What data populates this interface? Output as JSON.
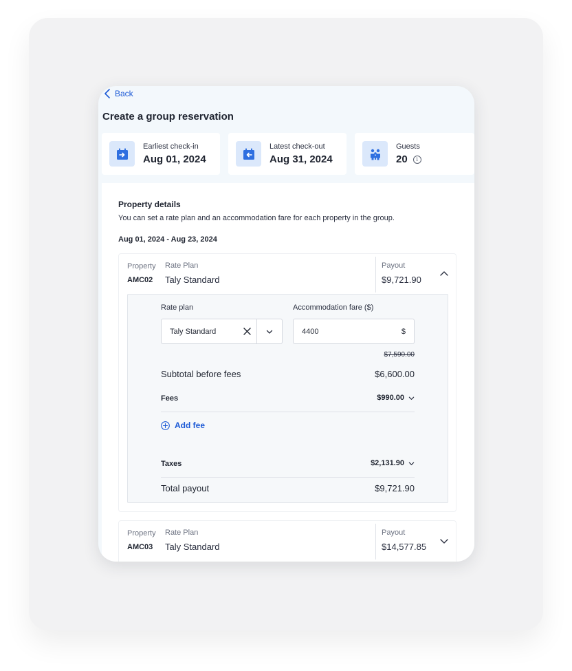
{
  "nav": {
    "back_label": "Back"
  },
  "page": {
    "title": "Create a group reservation"
  },
  "summary": {
    "checkin_label": "Earliest check-in",
    "checkin_value": "Aug 01, 2024",
    "checkout_label": "Latest check-out",
    "checkout_value": "Aug 31, 2024",
    "guests_label": "Guests",
    "guests_value": "20",
    "info_glyph": "i"
  },
  "details": {
    "title": "Property details",
    "description": "You can set a rate plan and an accommodation fare for each property in the group.",
    "date_range": "Aug 01, 2024 - Aug 23, 2024"
  },
  "properties": [
    {
      "property_label": "Property",
      "code": "AMC02",
      "rate_plan_label": "Rate Plan",
      "rate_plan": "Taly Standard",
      "payout_label": "Payout",
      "payout": "$9,721.90",
      "expanded": true
    },
    {
      "property_label": "Property",
      "code": "AMC03",
      "rate_plan_label": "Rate Plan",
      "rate_plan": "Taly Standard",
      "payout_label": "Payout",
      "payout": "$14,577.85",
      "expanded": false
    }
  ],
  "editor": {
    "rate_plan_label": "Rate plan",
    "rate_plan_value": "Taly Standard",
    "fare_label": "Accommodation fare ($)",
    "fare_value": "4400",
    "fare_suffix": "$",
    "original_price": "$7,590.00",
    "subtotal_label": "Subtotal before fees",
    "subtotal_value": "$6,600.00",
    "fees_label": "Fees",
    "fees_value": "$990.00",
    "add_fee_label": "Add fee",
    "taxes_label": "Taxes",
    "taxes_value": "$2,131.90",
    "total_label": "Total payout",
    "total_value": "$9,721.90"
  },
  "colors": {
    "accent": "#1e5bd6",
    "icon_bg": "#dbe8fb",
    "header_bg": "#f3f8fc"
  }
}
